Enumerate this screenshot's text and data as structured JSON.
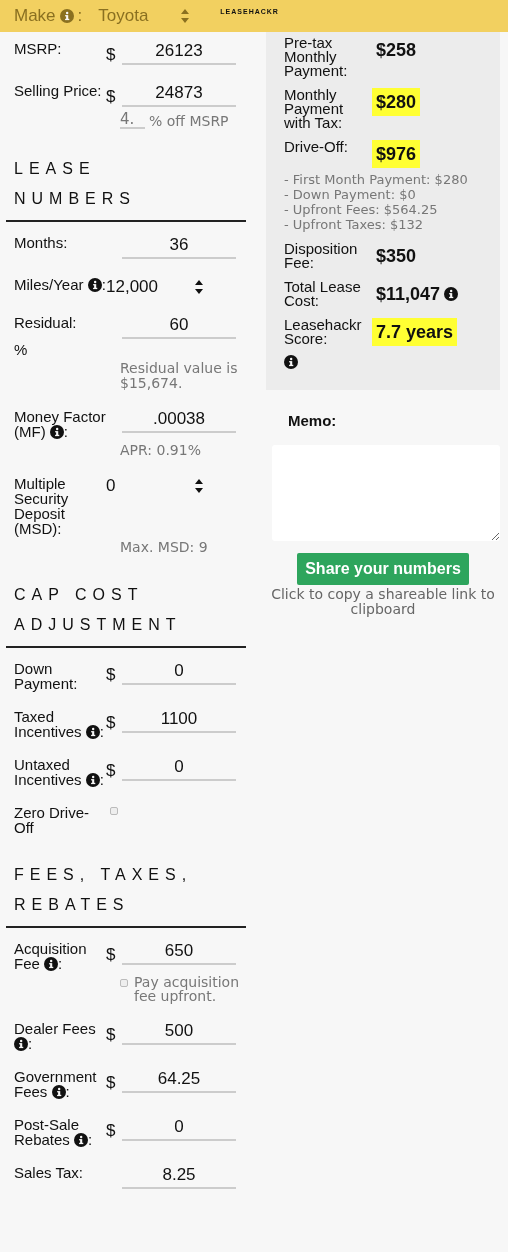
{
  "header": {
    "make_label": "Make",
    "make_suffix": ":",
    "make_value": "Toyota",
    "logo": "LEASEHACKR"
  },
  "sections": [
    {
      "fields": [
        {
          "kind": "input",
          "label": "MSRP:",
          "prefix": "$",
          "value": "26123"
        },
        {
          "kind": "input",
          "label": "Selling Price:",
          "prefix": "$",
          "value": "24873",
          "percent": {
            "value": "4.",
            "text": "% off MSRP"
          }
        }
      ]
    },
    {
      "heading": "LEASE NUMBERS",
      "fields": [
        {
          "kind": "input",
          "label": "Months:",
          "value": "36"
        },
        {
          "kind": "select",
          "label": "Miles/Year",
          "info": true,
          "suffix": ":",
          "value": "12,000"
        },
        {
          "kind": "input",
          "label": "Residual:",
          "unit": "%",
          "value": "60",
          "note": "Residual value is $15,674."
        },
        {
          "kind": "input",
          "label": "Money Factor (MF)",
          "info": true,
          "suffix": ":",
          "value": ".00038",
          "note": "APR: 0.91%"
        },
        {
          "kind": "select",
          "label": "Multiple Security Deposit (MSD):",
          "value": "0",
          "note": "Max. MSD: 9"
        }
      ]
    },
    {
      "heading": "CAP COST ADJUSTMENT",
      "fields": [
        {
          "kind": "input",
          "label": "Down Payment:",
          "prefix": "$",
          "value": "0"
        },
        {
          "kind": "input",
          "label": "Taxed Incentives",
          "info": true,
          "suffix": ":",
          "prefix": "$",
          "value": "1100"
        },
        {
          "kind": "input",
          "label": "Untaxed Incentives",
          "info": true,
          "suffix": ":",
          "prefix": "$",
          "value": "0"
        },
        {
          "kind": "checkbox",
          "label": "Zero Drive-Off",
          "checked": false
        }
      ]
    },
    {
      "heading": "FEES, TAXES, REBATES",
      "fields": [
        {
          "kind": "input",
          "label": "Acquisition Fee",
          "info": true,
          "suffix": ":",
          "prefix": "$",
          "value": "650",
          "option": {
            "text": "Pay acquisition fee upfront.",
            "checked": false
          }
        },
        {
          "kind": "input",
          "label": "Dealer Fees",
          "info": true,
          "suffix": ":",
          "prefix": "$",
          "value": "500"
        },
        {
          "kind": "input",
          "label": "Government Fees",
          "info": true,
          "suffix": ":",
          "prefix": "$",
          "value": "64.25"
        },
        {
          "kind": "input",
          "label": "Post-Sale Rebates",
          "info": true,
          "suffix": ":",
          "prefix": "$",
          "value": "0"
        },
        {
          "kind": "input",
          "label": "Sales Tax:",
          "value": "8.25"
        }
      ]
    }
  ],
  "results": [
    {
      "label": "Pre-tax Monthly Payment:",
      "value": "$258",
      "highlight": false
    },
    {
      "label": "Monthly Payment with Tax:",
      "value": "$280",
      "highlight": true
    },
    {
      "label": "Drive-Off:",
      "value": "$976",
      "highlight": true,
      "breakdown": [
        "- First Month Payment: $280",
        "- Down Payment: $0",
        "- Upfront Fees: $564.25",
        "- Upfront Taxes: $132"
      ]
    },
    {
      "label": "Disposition Fee:",
      "value": "$350",
      "highlight": false
    },
    {
      "label": "Total Lease Cost:",
      "value": "$11,047",
      "highlight": false,
      "info": true
    },
    {
      "label": "Leasehackr Score:",
      "value": "7.7 years",
      "highlight": true,
      "label_info": true
    }
  ],
  "memo": {
    "label": "Memo:"
  },
  "share": {
    "button": "Share your numbers",
    "hint": "Click to copy a shareable link to clipboard"
  }
}
